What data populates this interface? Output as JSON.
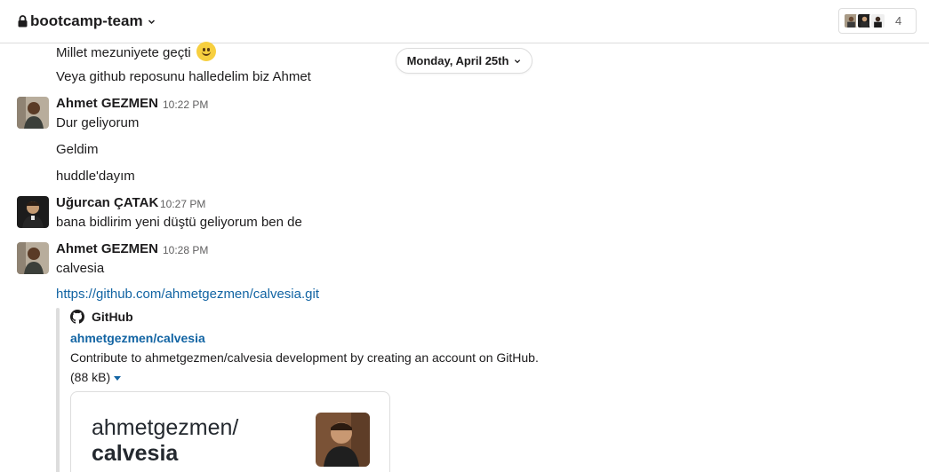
{
  "header": {
    "channel_name": "bootcamp-team",
    "member_count": "4"
  },
  "date_divider": "Monday, April 25th",
  "top_messages": [
    {
      "text": "Millet mezuniyete geçti"
    },
    {
      "text": "Veya github reposunu halledelim biz Ahmet"
    }
  ],
  "messages": [
    {
      "sender": "Ahmet GEZMEN",
      "time": "10:22 PM",
      "lines": [
        "Dur geliyorum",
        "Geldim",
        "huddle'dayım"
      ]
    },
    {
      "sender": "Uğurcan ÇATAK",
      "time": "10:27 PM",
      "lines": [
        "bana bidlirim yeni düştü geliyorum ben de"
      ]
    },
    {
      "sender": "Ahmet GEZMEN",
      "time": "10:28 PM",
      "lines": [
        "calvesia"
      ],
      "link": "https://github.com/ahmetgezmen/calvesia.git"
    }
  ],
  "unfurl": {
    "service": "GitHub",
    "title": "ahmetgezmen/calvesia",
    "description": "Contribute to ahmetgezmen/calvesia development by creating an account on GitHub.",
    "size": "(88 kB)",
    "card_owner": "ahmetgezmen/",
    "card_repo": "calvesia"
  },
  "icons": {
    "lock": "lock-icon",
    "chevron": "chevron-down-icon",
    "github": "github-icon",
    "emoji": "slightly-smiling-face-icon"
  },
  "colors": {
    "link": "#1264a3",
    "text": "#1d1c1d",
    "muted": "#616061",
    "border": "#dddddd",
    "emoji": "#f7cf3f"
  }
}
